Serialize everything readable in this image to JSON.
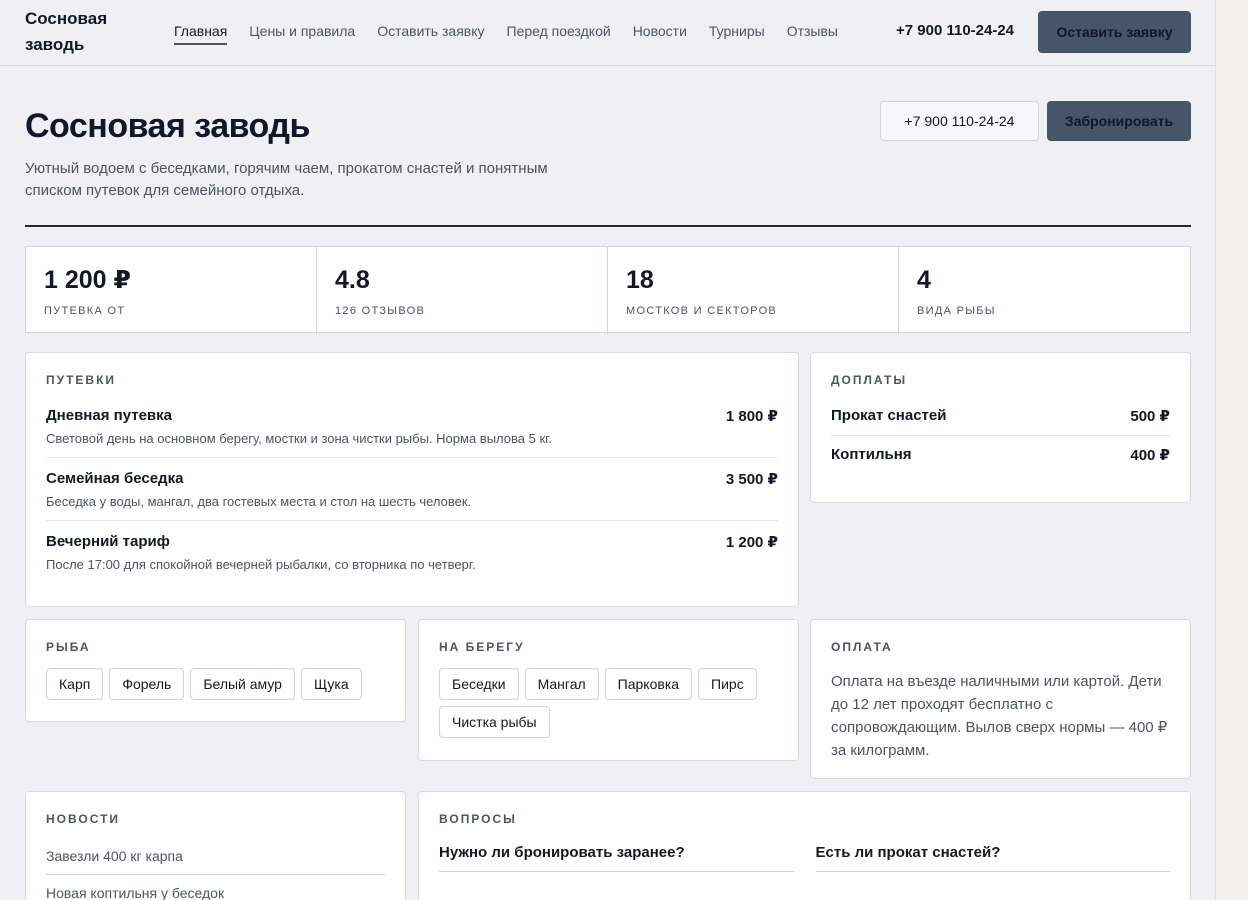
{
  "header": {
    "brand": "Сосновая\nзаводь",
    "nav": [
      "Главная",
      "Цены и правила",
      "Оставить заявку",
      "Перед поездкой",
      "Новости",
      "Турниры",
      "Отзывы"
    ],
    "phone": "+7 900 110-24-24",
    "cta": "Оставить заявку"
  },
  "hero": {
    "title": "Сосновая заводь",
    "subtitle": "Уютный водоем с беседками, горячим чаем, прокатом снастей и понятным списком путевок для семейного отдыха.",
    "phone_button": "+7 900 110-24-24",
    "book_button": "Забронировать"
  },
  "stats": [
    {
      "value": "1 200 ₽",
      "label": "Путевка от"
    },
    {
      "value": "4.8",
      "label": "126 отзывов"
    },
    {
      "value": "18",
      "label": "мостков и секторов"
    },
    {
      "value": "4",
      "label": "вида рыбы"
    }
  ],
  "tours": {
    "title": "Путевки",
    "items": [
      {
        "name": "Дневная путевка",
        "price": "1 800 ₽",
        "desc": "Световой день на основном берегу, мостки и зона чистки рыбы. Норма вылова 5 кг."
      },
      {
        "name": "Семейная беседка",
        "price": "3 500 ₽",
        "desc": "Беседка у воды, мангал, два гостевых места и стол на шесть человек."
      },
      {
        "name": "Вечерний тариф",
        "price": "1 200 ₽",
        "desc": "После 17:00 для спокойной вечерней рыбалки, со вторника по четверг."
      }
    ]
  },
  "extras": {
    "title": "Доплаты",
    "items": [
      {
        "name": "Прокат снастей",
        "price": "500 ₽"
      },
      {
        "name": "Коптильня",
        "price": "400 ₽"
      }
    ]
  },
  "fish": {
    "title": "Рыба",
    "items": [
      "Карп",
      "Форель",
      "Белый амур",
      "Щука"
    ]
  },
  "shore": {
    "title": "На берегу",
    "items": [
      "Беседки",
      "Мангал",
      "Парковка",
      "Пирс",
      "Чистка рыбы"
    ]
  },
  "payment": {
    "title": "Оплата",
    "text": "Оплата на въезде наличными или картой. Дети до 12 лет проходят бесплатно с сопровождающим. Вылов сверх нормы — 400 ₽ за килограмм."
  },
  "news": {
    "title": "Новости",
    "items": [
      "Завезли 400 кг карпа",
      "Новая коптильня у беседок"
    ]
  },
  "faq": {
    "title": "Вопросы",
    "items": [
      "Нужно ли бронировать заранее?",
      "Есть ли прокат снастей?"
    ]
  }
}
